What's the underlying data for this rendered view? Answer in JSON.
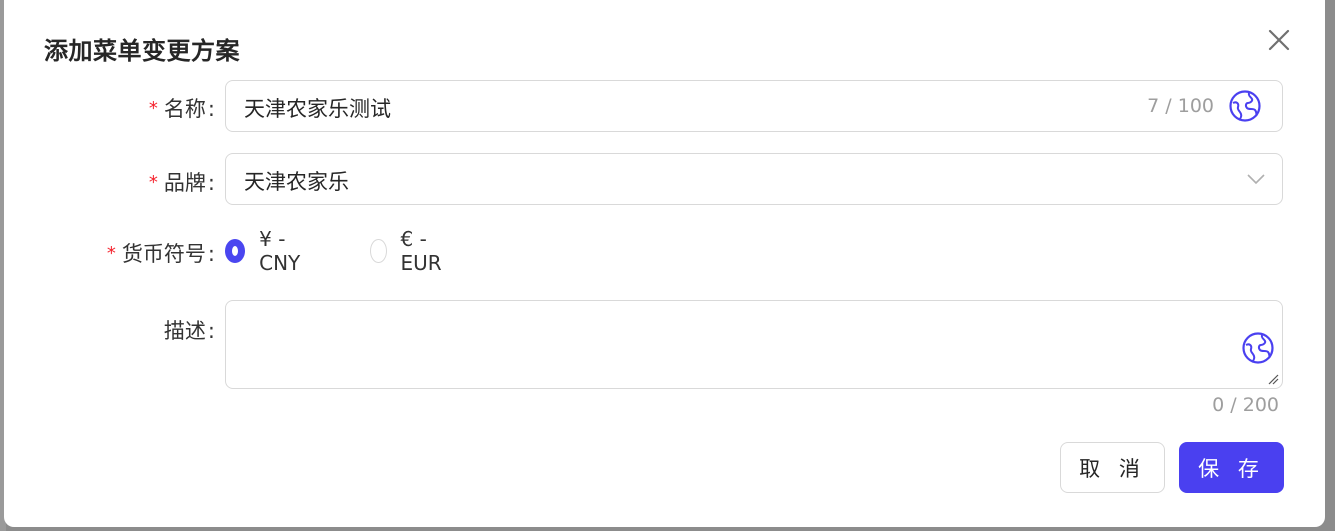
{
  "dialog": {
    "title": "添加菜单变更方案"
  },
  "form": {
    "name": {
      "label": "名称",
      "value": "天津农家乐测试",
      "counter": "7 / 100"
    },
    "brand": {
      "label": "品牌",
      "value": "天津农家乐"
    },
    "currency": {
      "label": "货币符号",
      "options": [
        {
          "label": "¥ - CNY",
          "checked": true
        },
        {
          "label": "€ - EUR",
          "checked": false
        }
      ]
    },
    "description": {
      "label": "描述",
      "value": "",
      "counter": "0 / 200"
    },
    "required_mark": "*",
    "colon": ":"
  },
  "buttons": {
    "cancel": "取 消",
    "save": "保 存"
  },
  "colors": {
    "primary": "#4a40f0",
    "required": "#f5222d",
    "border": "#d9d9d9"
  },
  "icons": {
    "close": "close-icon",
    "translate": "globe-icon",
    "select_arrow": "chevron-down-icon"
  }
}
